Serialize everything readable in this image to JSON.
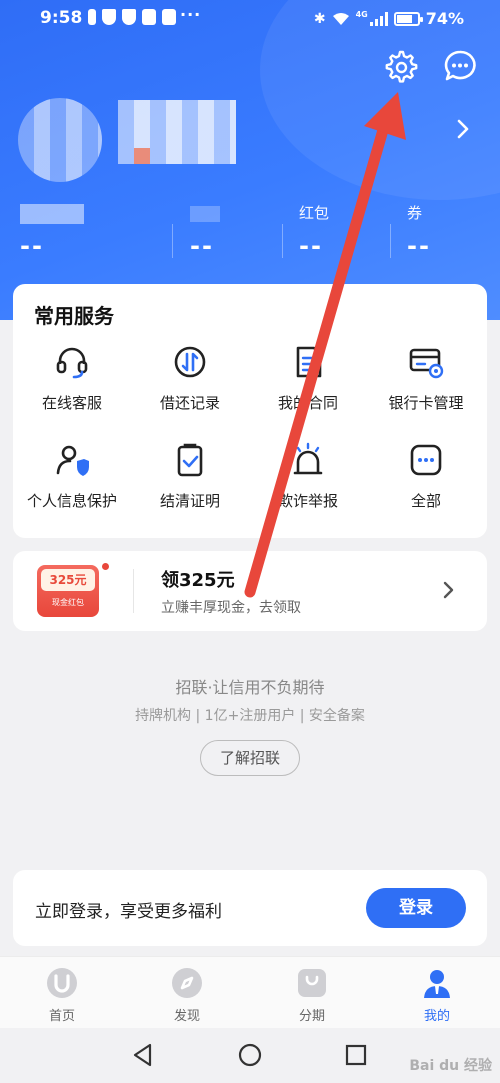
{
  "status_bar": {
    "time": "9:58",
    "dots": "···",
    "network": "4G",
    "battery_text": "74%",
    "battery_level": 0.74
  },
  "header": {
    "settings_icon": "gear-icon",
    "message_icon": "chat-bubble-icon",
    "profile_arrow": "chevron-right-icon"
  },
  "stats": [
    {
      "label": "",
      "value": "--"
    },
    {
      "label": "",
      "value": "--"
    },
    {
      "label": "红包",
      "value": "--"
    },
    {
      "label": "券",
      "value": "--"
    }
  ],
  "services": {
    "title": "常用服务",
    "items": [
      {
        "label": "在线客服",
        "icon": "headset-icon"
      },
      {
        "label": "借还记录",
        "icon": "transfer-circle-icon"
      },
      {
        "label": "我的合同",
        "icon": "document-icon"
      },
      {
        "label": "银行卡管理",
        "icon": "bank-card-gear-icon"
      },
      {
        "label": "个人信息保护",
        "icon": "user-shield-icon"
      },
      {
        "label": "结清证明",
        "icon": "clipboard-check-icon"
      },
      {
        "label": "欺诈举报",
        "icon": "alarm-icon"
      },
      {
        "label": "全部",
        "icon": "more-dots-icon"
      }
    ]
  },
  "promo": {
    "badge_amount": "325元",
    "badge_sub": "现金红包",
    "title": "领325元",
    "subtitle": "立赚丰厚现金，去领取"
  },
  "footer_info": {
    "slogan": "招联·让信用不负期待",
    "sub": "持牌机构 | 1亿+注册用户 | 安全备案",
    "learn_button": "了解招联"
  },
  "login": {
    "text": "立即登录，享受更多福利",
    "button": "登录"
  },
  "tabs": [
    {
      "label": "首页",
      "icon": "u-logo-icon",
      "active": false
    },
    {
      "label": "发现",
      "icon": "compass-icon",
      "active": false
    },
    {
      "label": "分期",
      "icon": "bag-icon",
      "active": false
    },
    {
      "label": "我的",
      "icon": "person-icon",
      "active": true
    }
  ],
  "watermark": "Bai du 经验",
  "colors": {
    "primary": "#2f6ff5",
    "annotation_arrow": "#e8473b"
  }
}
